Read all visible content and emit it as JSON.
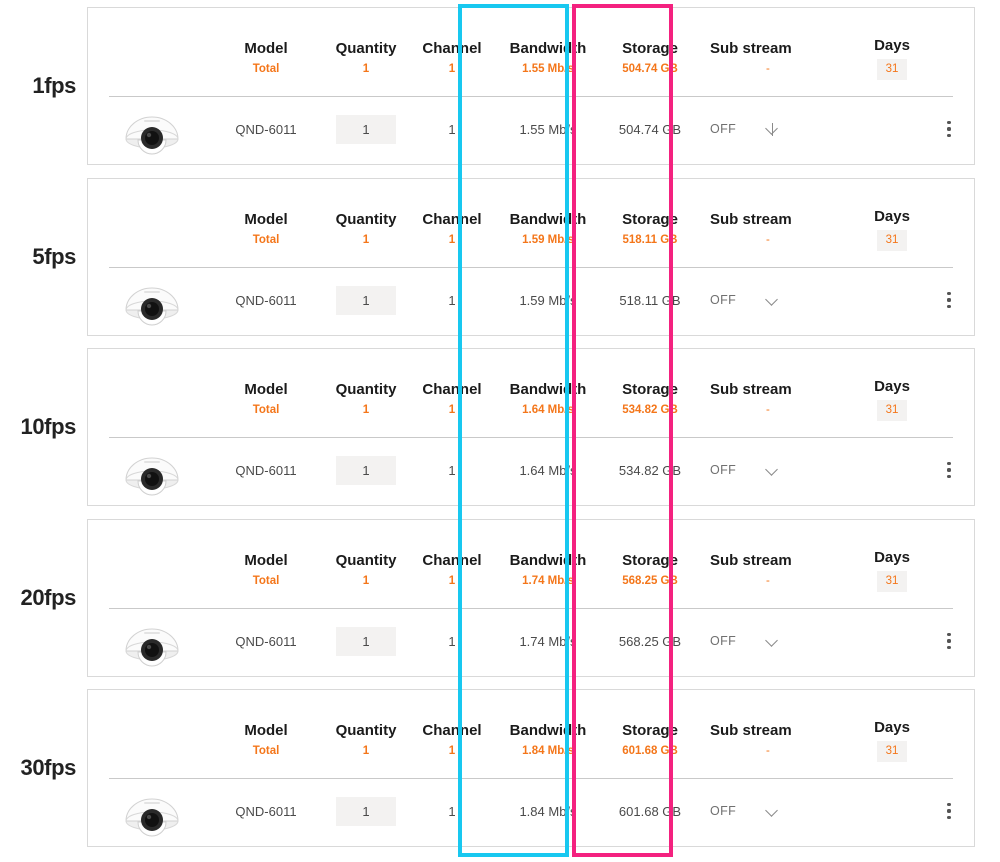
{
  "columns": {
    "model": "Model",
    "quantity": "Quantity",
    "channel": "Channel",
    "bandwidth": "Bandwidth",
    "storage": "Storage",
    "sub_stream": "Sub stream",
    "days": "Days"
  },
  "summary_labels": {
    "model_total": "Total",
    "sub_stream_total": "-"
  },
  "icons": {
    "camera": "dome-camera-icon",
    "chevron_down": "chevron-down-icon",
    "kebab": "more-options-icon"
  },
  "highlights": [
    {
      "name": "bandwidth-column-highlight",
      "color": "#18c8f0",
      "column": "Bandwidth"
    },
    {
      "name": "storage-column-highlight",
      "color": "#f4217f",
      "column": "Storage"
    }
  ],
  "accent_color": "#f4761a",
  "groups": [
    {
      "fps_label": "1fps",
      "totals": {
        "model": "Total",
        "quantity": "1",
        "channel": "1",
        "bandwidth": "1.55 Mb/s",
        "storage": "504.74 GB",
        "sub_stream": "-",
        "days": "31"
      },
      "rows": [
        {
          "model": "QND-6011",
          "quantity": "1",
          "channel": "1",
          "bandwidth": "1.55 Mb/s",
          "storage": "504.74 GB",
          "sub_stream": "OFF"
        }
      ]
    },
    {
      "fps_label": "5fps",
      "totals": {
        "model": "Total",
        "quantity": "1",
        "channel": "1",
        "bandwidth": "1.59 Mb/s",
        "storage": "518.11 GB",
        "sub_stream": "-",
        "days": "31"
      },
      "rows": [
        {
          "model": "QND-6011",
          "quantity": "1",
          "channel": "1",
          "bandwidth": "1.59 Mb/s",
          "storage": "518.11 GB",
          "sub_stream": "OFF"
        }
      ]
    },
    {
      "fps_label": "10fps",
      "totals": {
        "model": "Total",
        "quantity": "1",
        "channel": "1",
        "bandwidth": "1.64 Mb/s",
        "storage": "534.82 GB",
        "sub_stream": "-",
        "days": "31"
      },
      "rows": [
        {
          "model": "QND-6011",
          "quantity": "1",
          "channel": "1",
          "bandwidth": "1.64 Mb/s",
          "storage": "534.82 GB",
          "sub_stream": "OFF"
        }
      ]
    },
    {
      "fps_label": "20fps",
      "totals": {
        "model": "Total",
        "quantity": "1",
        "channel": "1",
        "bandwidth": "1.74 Mb/s",
        "storage": "568.25 GB",
        "sub_stream": "-",
        "days": "31"
      },
      "rows": [
        {
          "model": "QND-6011",
          "quantity": "1",
          "channel": "1",
          "bandwidth": "1.74 Mb/s",
          "storage": "568.25 GB",
          "sub_stream": "OFF"
        }
      ]
    },
    {
      "fps_label": "30fps",
      "totals": {
        "model": "Total",
        "quantity": "1",
        "channel": "1",
        "bandwidth": "1.84 Mb/s",
        "storage": "601.68 GB",
        "sub_stream": "-",
        "days": "31"
      },
      "rows": [
        {
          "model": "QND-6011",
          "quantity": "1",
          "channel": "1",
          "bandwidth": "1.84 Mb/s",
          "storage": "601.68 GB",
          "sub_stream": "OFF"
        }
      ]
    }
  ]
}
